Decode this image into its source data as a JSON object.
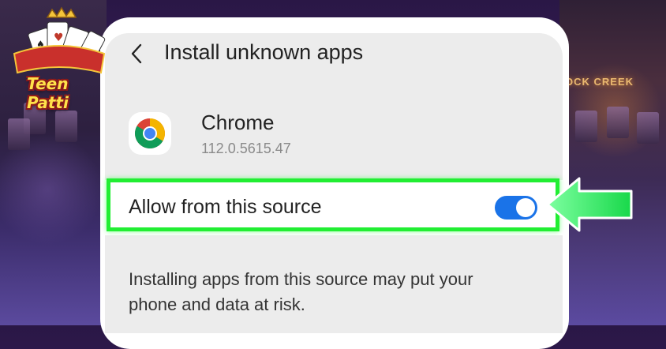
{
  "branding": {
    "logo_text": "Teen Patti"
  },
  "background": {
    "sign_text": "OCK CREEK"
  },
  "header": {
    "title": "Install unknown apps",
    "back_icon": "chevron-left-icon"
  },
  "app": {
    "name": "Chrome",
    "version": "112.0.5615.47",
    "icon": "chrome-icon"
  },
  "setting": {
    "label": "Allow from this source",
    "enabled": true,
    "toggle_color": "#1a73e8"
  },
  "warning": {
    "text": "Installing apps from this source may put your phone and data at risk."
  },
  "annotations": {
    "highlight_color": "#22ee33",
    "arrow_icon": "green-arrow-left-icon"
  }
}
